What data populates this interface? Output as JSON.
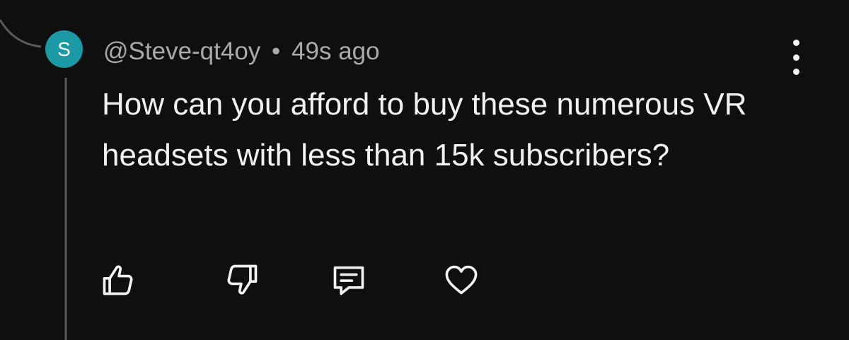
{
  "comment": {
    "avatar_letter": "S",
    "author": "@Steve-qt4oy",
    "separator": "•",
    "timestamp": "49s ago",
    "text": "How can you afford to buy these numerous VR headsets with less than 15k subscribers?"
  },
  "colors": {
    "background": "#0f0f0f",
    "avatar": "#1b9aa5",
    "text": "#f1f1f1",
    "meta": "#aaaaaa",
    "thread_line": "#5a5a5a"
  },
  "icons": {
    "more": "more-vertical-icon",
    "like": "thumbs-up-icon",
    "dislike": "thumbs-down-icon",
    "reply": "reply-comment-icon",
    "heart": "heart-icon"
  }
}
